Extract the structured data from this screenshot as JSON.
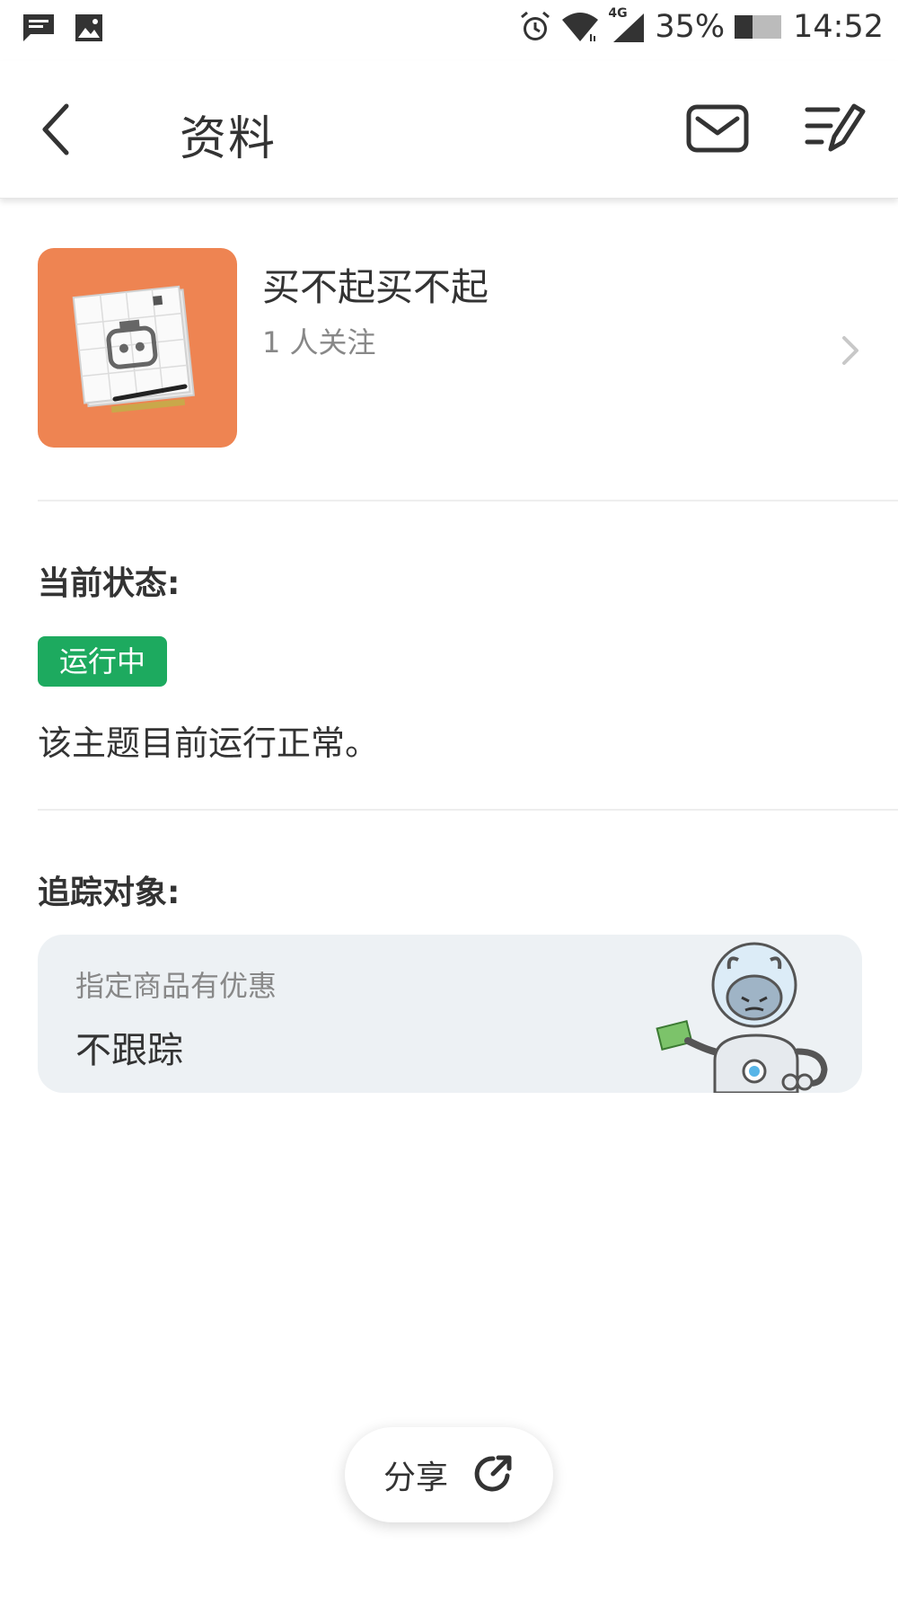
{
  "status_bar": {
    "left_icons": [
      "message-icon",
      "image-icon"
    ],
    "right_icons": [
      "alarm-icon",
      "wifi-icon",
      "signal-4g-icon",
      "battery-icon"
    ],
    "network": "4G",
    "battery": "35%",
    "time": "14:52"
  },
  "header": {
    "title": "资料",
    "icons": [
      "back-icon",
      "mail-icon",
      "edit-list-icon"
    ]
  },
  "profile": {
    "name": "买不起买不起",
    "followers": "1 人关注",
    "avatar_color": "#ee8452"
  },
  "status_section": {
    "title": "当前状态:",
    "badge": "运行中",
    "badge_color": "#1daa5f",
    "description": "该主题目前运行正常。"
  },
  "tracking_section": {
    "title": "追踪对象:",
    "card_label": "指定商品有优惠",
    "card_value": "不跟踪",
    "card_bg": "#edf1f4"
  },
  "share": {
    "label": "分享",
    "icon": "share-icon"
  }
}
